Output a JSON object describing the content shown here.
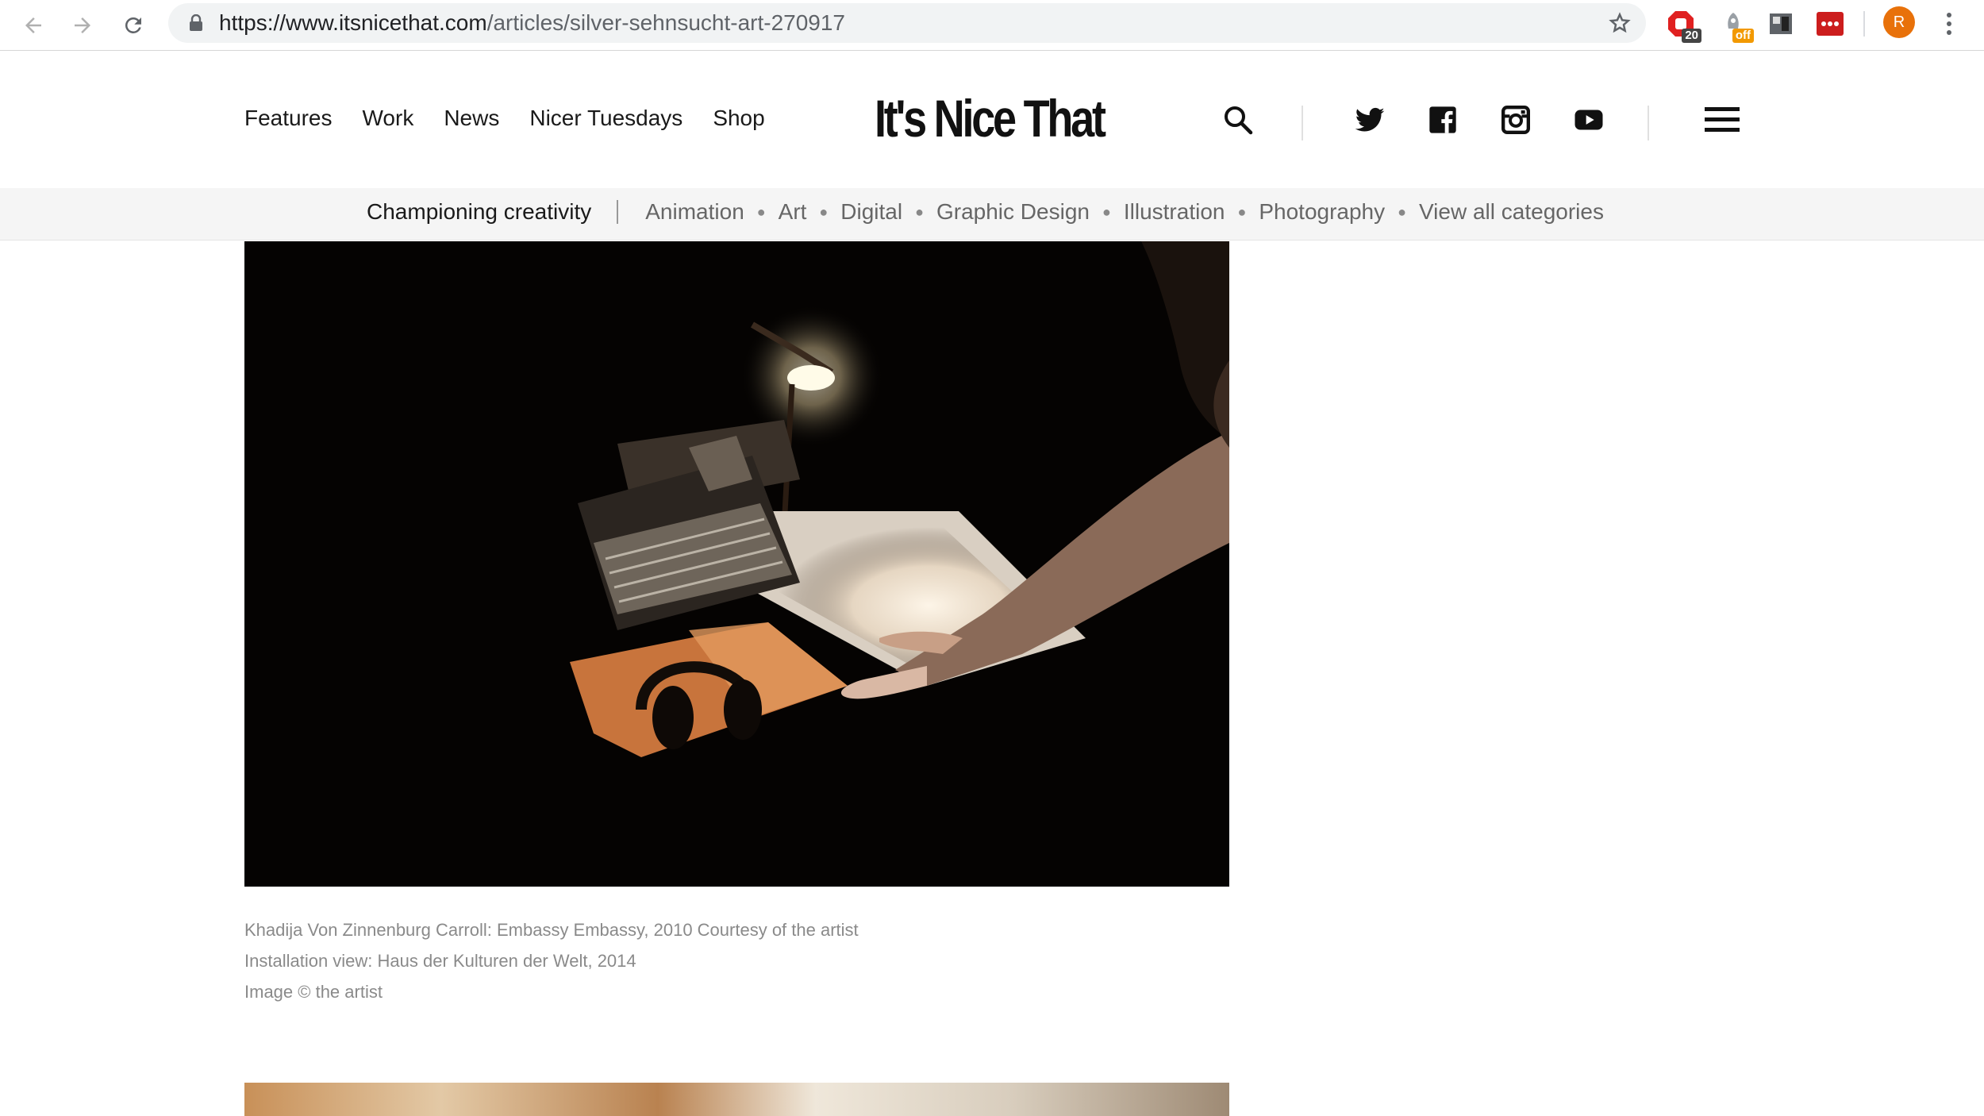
{
  "browser": {
    "url_domain": "https://www.itsnicethat.com",
    "url_path": "/articles/silver-sehnsucht-art-270917",
    "extensions": [
      {
        "name": "adblock-icon",
        "badge": "20",
        "badge_color": "#444444"
      },
      {
        "name": "rocket-extension-icon",
        "badge": "off",
        "badge_color": "#f29900"
      },
      {
        "name": "page-split-extension-icon",
        "badge": ""
      },
      {
        "name": "lastpass-icon",
        "badge": ""
      }
    ],
    "profile_initial": "R"
  },
  "site": {
    "logo": "It's Nice That",
    "nav": [
      "Features",
      "Work",
      "News",
      "Nicer Tuesdays",
      "Shop"
    ],
    "tagline": "Championing creativity",
    "categories": [
      "Animation",
      "Art",
      "Digital",
      "Graphic Design",
      "Illustration",
      "Photography",
      "View all categories"
    ]
  },
  "article": {
    "caption_lines": [
      "Khadija Von Zinnenburg Carroll: Embassy Embassy, 2010 Courtesy of the artist",
      "Installation view: Haus der Kulturen der Welt, 2014",
      "Image © the artist"
    ]
  },
  "colors": {
    "avatar": "#e8710a",
    "catbar": "#f5f5f5"
  }
}
